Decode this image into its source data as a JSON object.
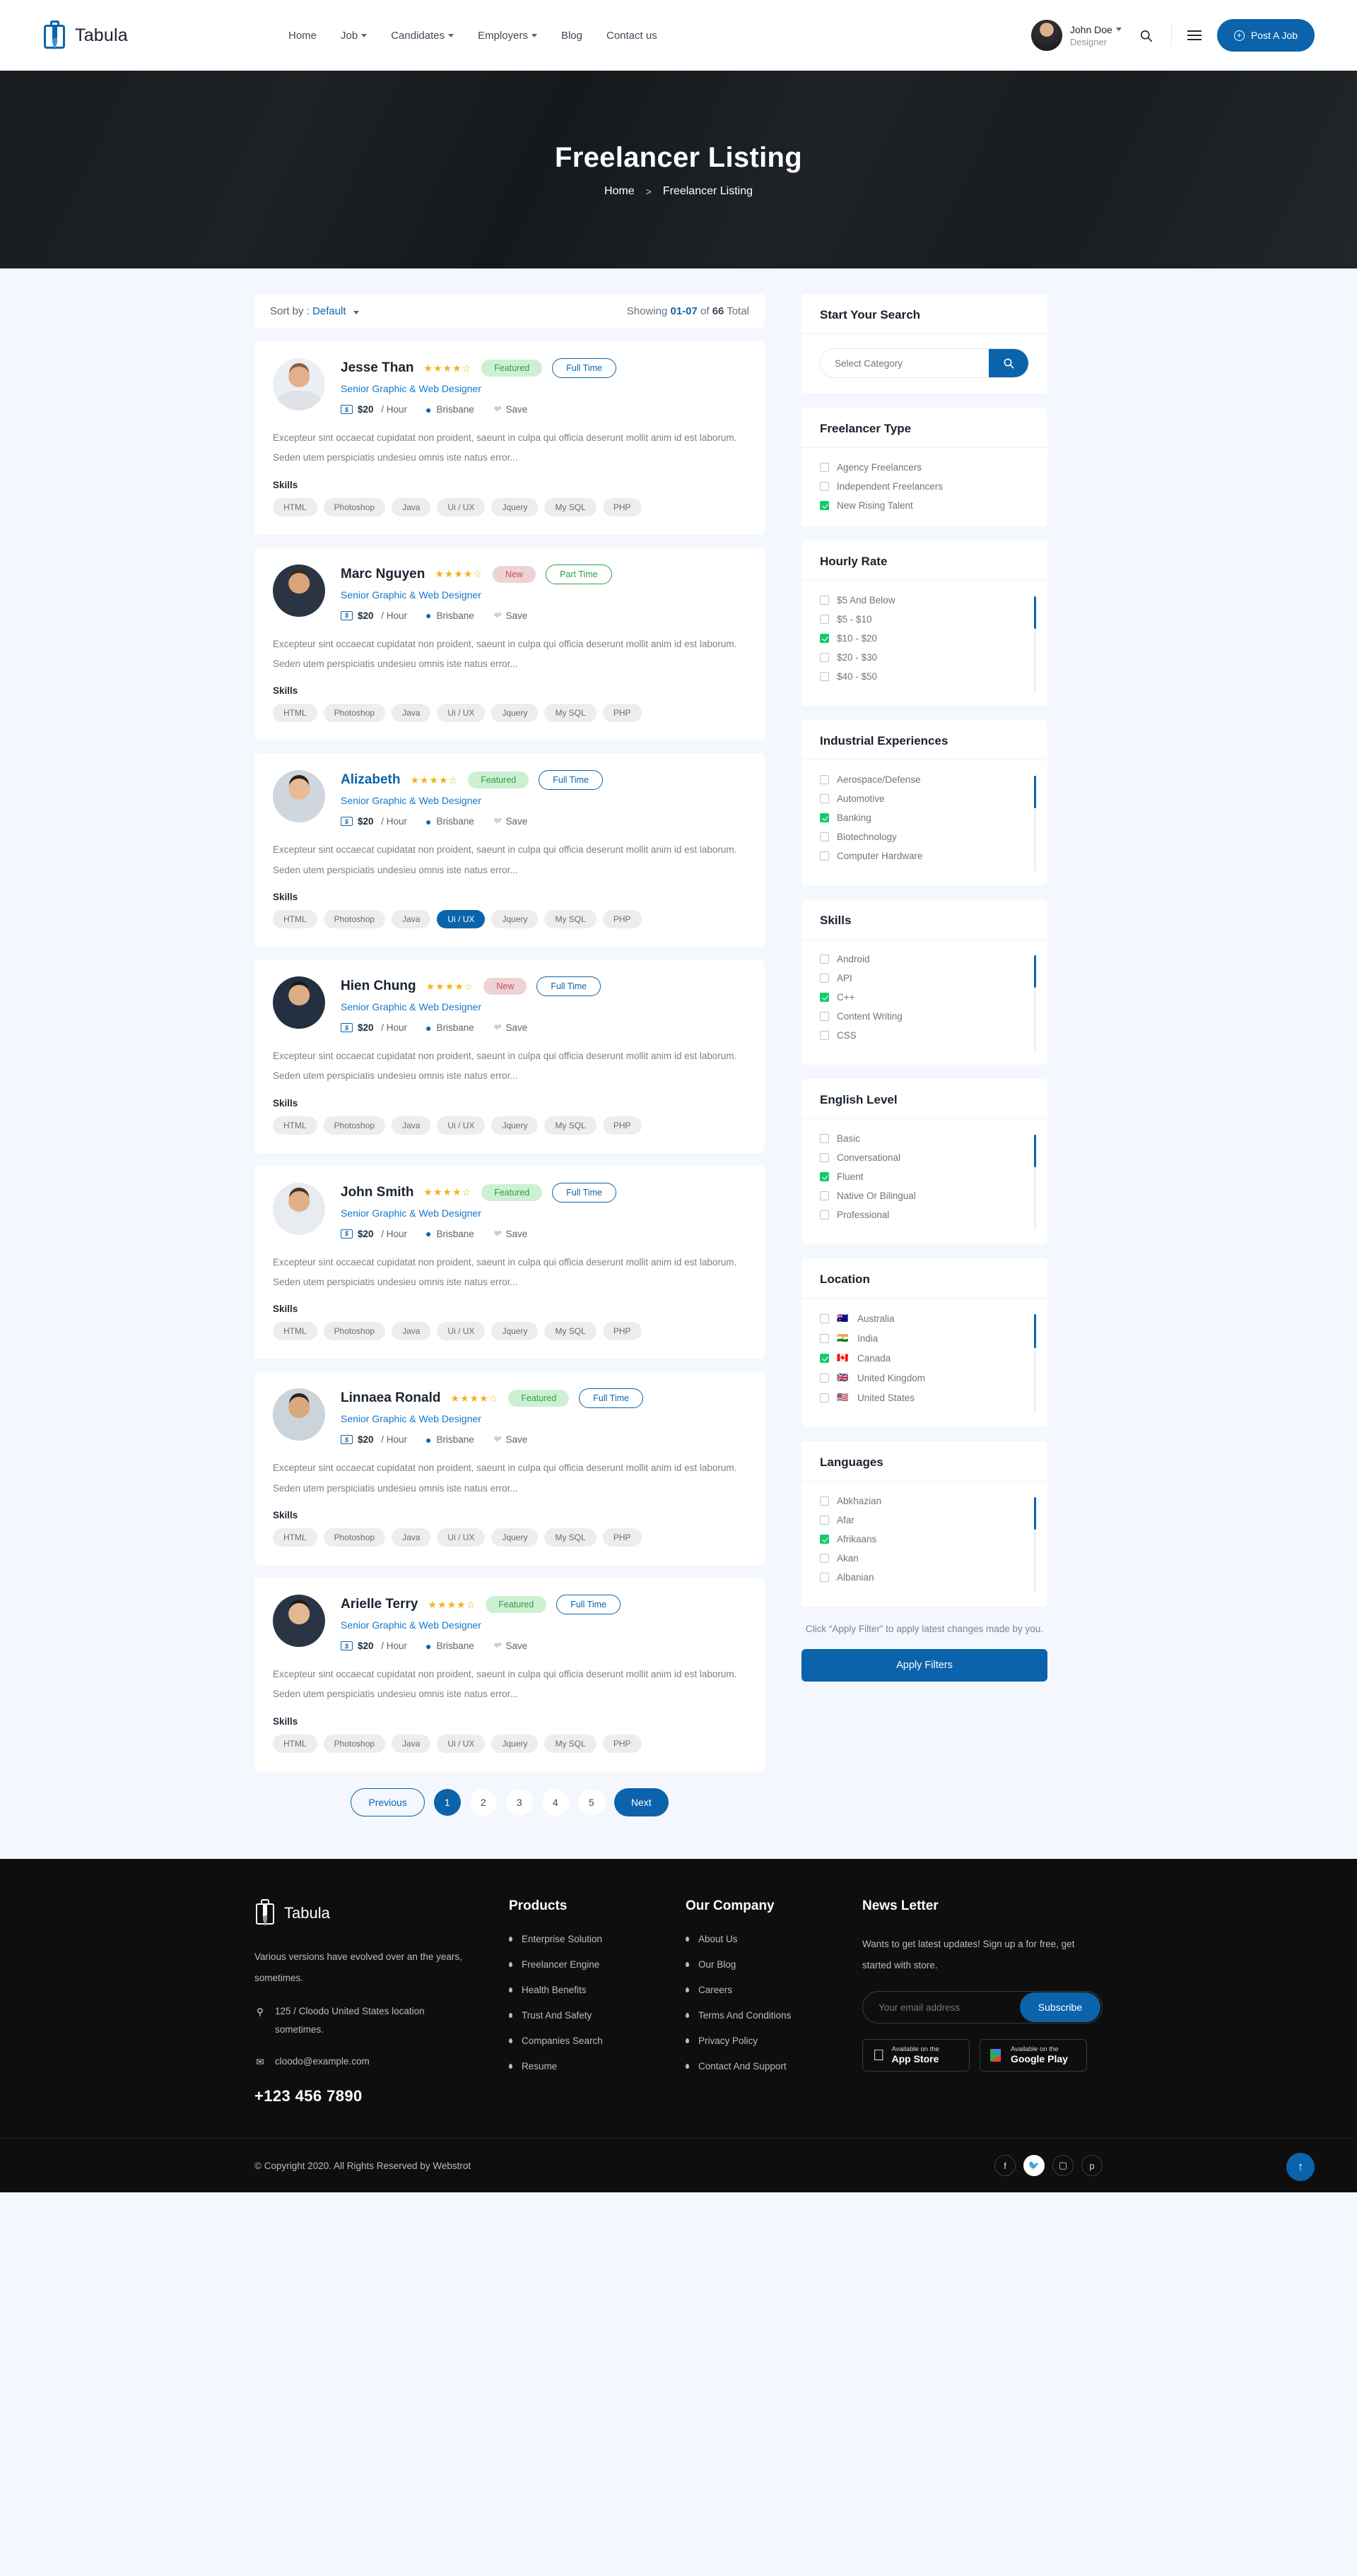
{
  "header": {
    "brand": "Tabula",
    "nav": [
      {
        "label": "Home",
        "caret": false
      },
      {
        "label": "Job",
        "caret": true
      },
      {
        "label": "Candidates",
        "caret": true
      },
      {
        "label": "Employers",
        "caret": true
      },
      {
        "label": "Blog",
        "caret": false
      },
      {
        "label": "Contact us",
        "caret": false
      }
    ],
    "user": {
      "name": "John Doe",
      "role": "Designer"
    },
    "search_icon": "search-icon",
    "menu_icon": "hamburger-icon",
    "post_job": "Post A Job"
  },
  "hero": {
    "title": "Freelancer Listing",
    "breadcrumb": {
      "home": "Home",
      "sep": ">",
      "current": "Freelancer Listing"
    }
  },
  "sortbar": {
    "sort_label": "Sort by :",
    "sort_value": "Default",
    "showing_prefix": "Showing",
    "showing_range": "01-07",
    "showing_of": "of",
    "showing_total": "66",
    "showing_suffix": "Total"
  },
  "listings": [
    {
      "name": "Jesse Than",
      "name_link": false,
      "rating": 4,
      "badge": "Featured",
      "badge_type": "feat",
      "job_type": "Full Time",
      "job_type_class": "full",
      "title": "Senior Graphic & Web Designer",
      "rate": "$20",
      "rate_unit": "/ Hour",
      "location": "Brisbane",
      "save": "Save",
      "desc": "Excepteur sint occaecat cupidatat non proident, saeunt in culpa qui officia deserunt mollit anim id est laborum. Seden utem perspiciatis undesieu omnis iste natus error...",
      "skills_label": "Skills",
      "skills": [
        "HTML",
        "Photoshop",
        "Java",
        "Ui / UX",
        "Jquery",
        "My SQL",
        "PHP"
      ],
      "active_skill": null,
      "avatar": {
        "skin": "#e2b08a",
        "hair": "#8a6240",
        "cloth": "#eceff3"
      }
    },
    {
      "name": "Marc Nguyen",
      "name_link": false,
      "rating": 4,
      "badge": "New",
      "badge_type": "new",
      "job_type": "Part Time",
      "job_type_class": "part",
      "title": "Senior Graphic & Web Designer",
      "rate": "$20",
      "rate_unit": "/ Hour",
      "location": "Brisbane",
      "save": "Save",
      "desc": "Excepteur sint occaecat cupidatat non proident, saeunt in culpa qui officia deserunt mollit anim id est laborum. Seden utem perspiciatis undesieu omnis iste natus error...",
      "skills_label": "Skills",
      "skills": [
        "HTML",
        "Photoshop",
        "Java",
        "Ui / UX",
        "Jquery",
        "My SQL",
        "PHP"
      ],
      "active_skill": null,
      "avatar": {
        "skin": "#d9a47c",
        "hair": "#3a2a1e",
        "cloth": "#2b3442"
      }
    },
    {
      "name": "Alizabeth",
      "name_link": true,
      "rating": 4,
      "badge": "Featured",
      "badge_type": "feat",
      "job_type": "Full Time",
      "job_type_class": "full",
      "title": "Senior Graphic & Web Designer",
      "rate": "$20",
      "rate_unit": "/ Hour",
      "location": "Brisbane",
      "save": "Save",
      "desc": "Excepteur sint occaecat cupidatat non proident, saeunt in culpa qui officia deserunt mollit anim id est laborum. Seden utem perspiciatis undesieu omnis iste natus error...",
      "skills_label": "Skills",
      "skills": [
        "HTML",
        "Photoshop",
        "Java",
        "Ui / UX",
        "Jquery",
        "My SQL",
        "PHP"
      ],
      "active_skill": "Ui / UX",
      "avatar": {
        "skin": "#e6bb96",
        "hair": "#27201c",
        "cloth": "#cfd6de"
      }
    },
    {
      "name": "Hien Chung",
      "name_link": false,
      "rating": 4,
      "badge": "New",
      "badge_type": "new",
      "job_type": "Full Time",
      "job_type_class": "full",
      "title": "Senior Graphic & Web Designer",
      "rate": "$20",
      "rate_unit": "/ Hour",
      "location": "Brisbane",
      "save": "Save",
      "desc": "Excepteur sint occaecat cupidatat non proident, saeunt in culpa qui officia deserunt mollit anim id est laborum. Seden utem perspiciatis undesieu omnis iste natus error...",
      "skills_label": "Skills",
      "skills": [
        "HTML",
        "Photoshop",
        "Java",
        "Ui / UX",
        "Jquery",
        "My SQL",
        "PHP"
      ],
      "active_skill": null,
      "avatar": {
        "skin": "#dcae86",
        "hair": "#201a16",
        "cloth": "#243040"
      }
    },
    {
      "name": "John Smith",
      "name_link": false,
      "rating": 4,
      "badge": "Featured",
      "badge_type": "feat",
      "job_type": "Full Time",
      "job_type_class": "full",
      "title": "Senior Graphic & Web Designer",
      "rate": "$20",
      "rate_unit": "/ Hour",
      "location": "Brisbane",
      "save": "Save",
      "desc": "Excepteur sint occaecat cupidatat non proident, saeunt in culpa qui officia deserunt mollit anim id est laborum. Seden utem perspiciatis undesieu omnis iste natus error...",
      "skills_label": "Skills",
      "skills": [
        "HTML",
        "Photoshop",
        "Java",
        "Ui / UX",
        "Jquery",
        "My SQL",
        "PHP"
      ],
      "active_skill": null,
      "avatar": {
        "skin": "#e0b089",
        "hair": "#4a3526",
        "cloth": "#e8ebef"
      }
    },
    {
      "name": "Linnaea Ronald",
      "name_link": false,
      "rating": 4,
      "badge": "Featured",
      "badge_type": "feat",
      "job_type": "Full Time",
      "job_type_class": "full",
      "title": "Senior Graphic & Web Designer",
      "rate": "$20",
      "rate_unit": "/ Hour",
      "location": "Brisbane",
      "save": "Save",
      "desc": "Excepteur sint occaecat cupidatat non proident, saeunt in culpa qui officia deserunt mollit anim id est laborum. Seden utem perspiciatis undesieu omnis iste natus error...",
      "skills_label": "Skills",
      "skills": [
        "HTML",
        "Photoshop",
        "Java",
        "Ui / UX",
        "Jquery",
        "My SQL",
        "PHP"
      ],
      "active_skill": null,
      "avatar": {
        "skin": "#d8a87f",
        "hair": "#2e231b",
        "cloth": "#cbd3db"
      }
    },
    {
      "name": "Arielle Terry",
      "name_link": false,
      "rating": 4,
      "badge": "Featured",
      "badge_type": "feat",
      "job_type": "Full Time",
      "job_type_class": "full",
      "title": "Senior Graphic & Web Designer",
      "rate": "$20",
      "rate_unit": "/ Hour",
      "location": "Brisbane",
      "save": "Save",
      "desc": "Excepteur sint occaecat cupidatat non proident, saeunt in culpa qui officia deserunt mollit anim id est laborum. Seden utem perspiciatis undesieu omnis iste natus error...",
      "skills_label": "Skills",
      "skills": [
        "HTML",
        "Photoshop",
        "Java",
        "Ui / UX",
        "Jquery",
        "My SQL",
        "PHP"
      ],
      "active_skill": null,
      "avatar": {
        "skin": "#e3b793",
        "hair": "#1f1a16",
        "cloth": "#2a3444"
      }
    }
  ],
  "pagination": {
    "previous": "Previous",
    "next": "Next",
    "pages": [
      "1",
      "2",
      "3",
      "4",
      "5"
    ],
    "active": "1"
  },
  "sidebar": {
    "search": {
      "heading": "Start Your Search",
      "placeholder": "Select Category",
      "button_icon": "search-icon"
    },
    "panels": [
      {
        "heading": "Freelancer Type",
        "scroll": false,
        "items": [
          {
            "label": "Agency Freelancers",
            "checked": false
          },
          {
            "label": "Independent Freelancers",
            "checked": false
          },
          {
            "label": "New Rising Talent",
            "checked": true
          }
        ]
      },
      {
        "heading": "Hourly Rate",
        "scroll": true,
        "thumb": "34%",
        "items": [
          {
            "label": "$5 And Below",
            "checked": false
          },
          {
            "label": "$5 - $10",
            "checked": false
          },
          {
            "label": "$10 - $20",
            "checked": true
          },
          {
            "label": "$20 - $30",
            "checked": false
          },
          {
            "label": "$40 - $50",
            "checked": false
          }
        ]
      },
      {
        "heading": "Industrial Experiences",
        "scroll": true,
        "thumb": "34%",
        "items": [
          {
            "label": "Aerospace/Defense",
            "checked": false
          },
          {
            "label": "Automotive",
            "checked": false
          },
          {
            "label": "Banking",
            "checked": true
          },
          {
            "label": "Biotechnology",
            "checked": false
          },
          {
            "label": "Computer Hardware",
            "checked": false
          }
        ]
      },
      {
        "heading": "Skills",
        "scroll": true,
        "thumb": "34%",
        "items": [
          {
            "label": "Android",
            "checked": false
          },
          {
            "label": "API",
            "checked": false
          },
          {
            "label": "C++",
            "checked": true
          },
          {
            "label": "Content Writing",
            "checked": false
          },
          {
            "label": "CSS",
            "checked": false
          }
        ]
      },
      {
        "heading": "English Level",
        "scroll": true,
        "thumb": "34%",
        "items": [
          {
            "label": "Basic",
            "checked": false
          },
          {
            "label": "Conversational",
            "checked": false
          },
          {
            "label": "Fluent",
            "checked": true
          },
          {
            "label": "Native Or Bilingual",
            "checked": false
          },
          {
            "label": "Professional",
            "checked": false
          }
        ]
      },
      {
        "heading": "Location",
        "scroll": true,
        "thumb": "34%",
        "items": [
          {
            "label": "Australia",
            "checked": false,
            "flag": "🇦🇺"
          },
          {
            "label": "India",
            "checked": false,
            "flag": "🇮🇳"
          },
          {
            "label": "Canada",
            "checked": true,
            "flag": "🇨🇦"
          },
          {
            "label": "United Kingdom",
            "checked": false,
            "flag": "🇬🇧"
          },
          {
            "label": "United States",
            "checked": false,
            "flag": "🇺🇸"
          }
        ]
      },
      {
        "heading": "Languages",
        "scroll": true,
        "thumb": "34%",
        "items": [
          {
            "label": "Abkhazian",
            "checked": false
          },
          {
            "label": "Afar",
            "checked": false
          },
          {
            "label": "Afrikaans",
            "checked": true
          },
          {
            "label": "Akan",
            "checked": false
          },
          {
            "label": "Albanian",
            "checked": false
          }
        ]
      }
    ],
    "apply_note": "Click “Apply Filter” to apply latest changes made by you.",
    "apply_button": "Apply Filters"
  },
  "footer": {
    "brand": "Tabula",
    "about": "Various versions have evolved over an the years, sometimes.",
    "address": "125 / Cloodo United States location sometimes.",
    "email": "cloodo@example.com",
    "phone": "+123 456 7890",
    "products": {
      "heading": "Products",
      "items": [
        "Enterprise Solution",
        "Freelancer Engine",
        "Health Benefits",
        "Trust And Safety",
        "Companies Search",
        "Resume"
      ]
    },
    "company": {
      "heading": "Our Company",
      "items": [
        "About Us",
        "Our Blog",
        "Careers",
        "Terms And Conditions",
        "Privacy Policy",
        "Contact And Support"
      ]
    },
    "newsletter": {
      "heading": "News Letter",
      "text": "Wants to get latest updates! Sign up a for free, get started with store.",
      "placeholder": "Your email address",
      "button": "Subscribe",
      "appstore_top": "Available on the",
      "appstore_bottom": "App Store",
      "play_top": "Available on the",
      "play_bottom": "Google Play"
    },
    "copyright": "© Copyright 2020. All Rights Reserved by Webstrot",
    "socials": [
      "f",
      "t",
      "ig",
      "p"
    ]
  },
  "colors": {
    "brand": "#0b64ab",
    "accent_green": "#14cb6c",
    "badge_feat_bg": "#cdf0d2",
    "badge_new_bg": "#efd2d5",
    "star": "#f0b418"
  }
}
